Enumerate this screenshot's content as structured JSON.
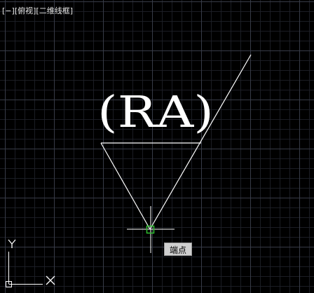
{
  "viewport_controls": {
    "viewport_menu": "[−]",
    "view_name": "[俯视]",
    "visual_style": "[二维线框]"
  },
  "drawing": {
    "text_object": "(RA)",
    "line_color": "#ffffff"
  },
  "crosshair": {
    "color": "#ffffff",
    "snap_marker_color": "#2fbf2f",
    "snap_tooltip": "端点"
  },
  "ucs_icon": {
    "x_label": "X",
    "y_label": "Y"
  },
  "colors": {
    "background": "#000000",
    "grid_major": "#3a3e4a",
    "grid_minor": "#1e2028",
    "tooltip_bg": "#cfcfcf"
  }
}
